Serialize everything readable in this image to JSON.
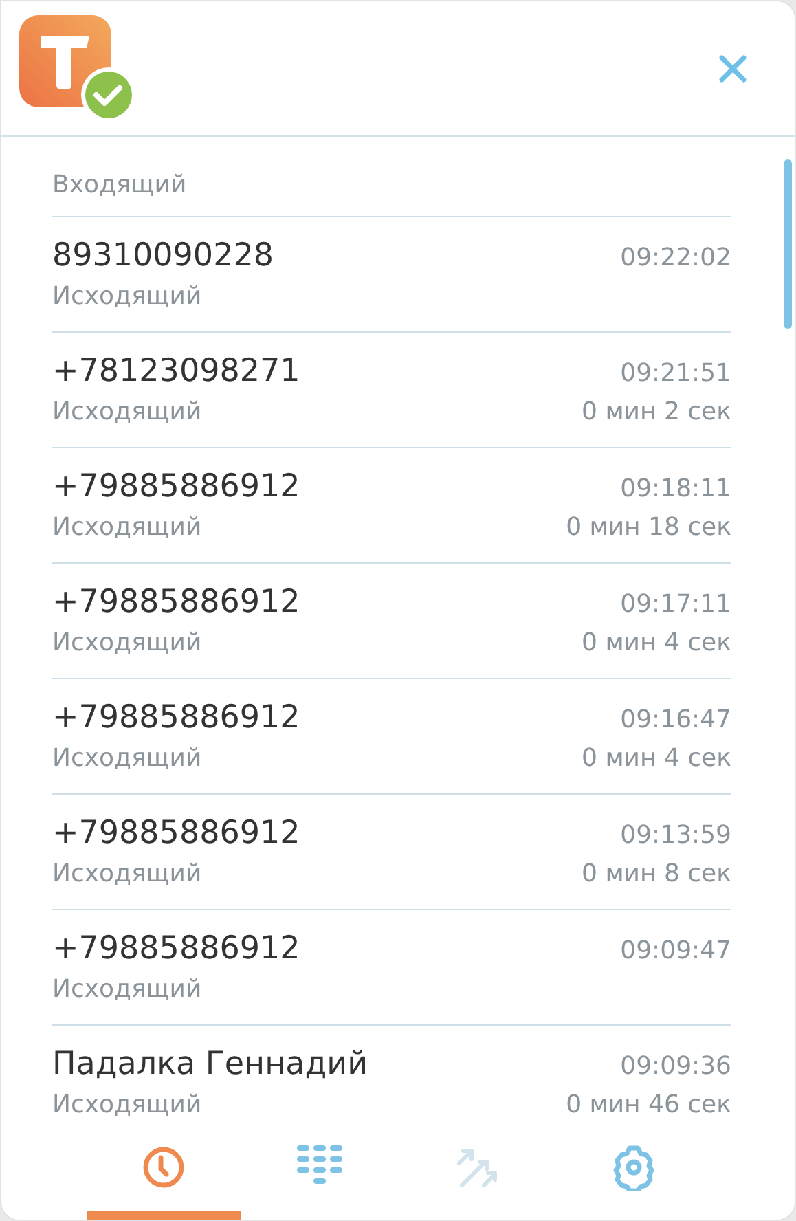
{
  "calls": [
    {
      "kind": "partial",
      "type": "Входящий"
    },
    {
      "kind": "full",
      "name": "89310090228",
      "time": "09:22:02",
      "type": "Исходящий"
    },
    {
      "kind": "full",
      "name": "+78123098271",
      "time": "09:21:51",
      "type": "Исходящий",
      "duration": "0 мин 2 сек"
    },
    {
      "kind": "full",
      "name": "+79885886912",
      "time": "09:18:11",
      "type": "Исходящий",
      "duration": "0 мин 18 сек"
    },
    {
      "kind": "full",
      "name": "+79885886912",
      "time": "09:17:11",
      "type": "Исходящий",
      "duration": "0 мин 4 сек"
    },
    {
      "kind": "full",
      "name": "+79885886912",
      "time": "09:16:47",
      "type": "Исходящий",
      "duration": "0 мин 4 сек"
    },
    {
      "kind": "full",
      "name": "+79885886912",
      "time": "09:13:59",
      "type": "Исходящий",
      "duration": "0 мин 8 сек"
    },
    {
      "kind": "full",
      "name": "+79885886912",
      "time": "09:09:47",
      "type": "Исходящий"
    },
    {
      "kind": "full",
      "name": "Падалка Геннадий",
      "time": "09:09:36",
      "type": "Исходящий",
      "duration": "0 мин 46 сек"
    }
  ],
  "tabs": [
    {
      "kind": "history",
      "selected": true,
      "disabled": false
    },
    {
      "kind": "dialpad",
      "selected": false,
      "disabled": false
    },
    {
      "kind": "transfer",
      "selected": false,
      "disabled": true
    },
    {
      "kind": "settings",
      "selected": false,
      "disabled": false
    }
  ]
}
